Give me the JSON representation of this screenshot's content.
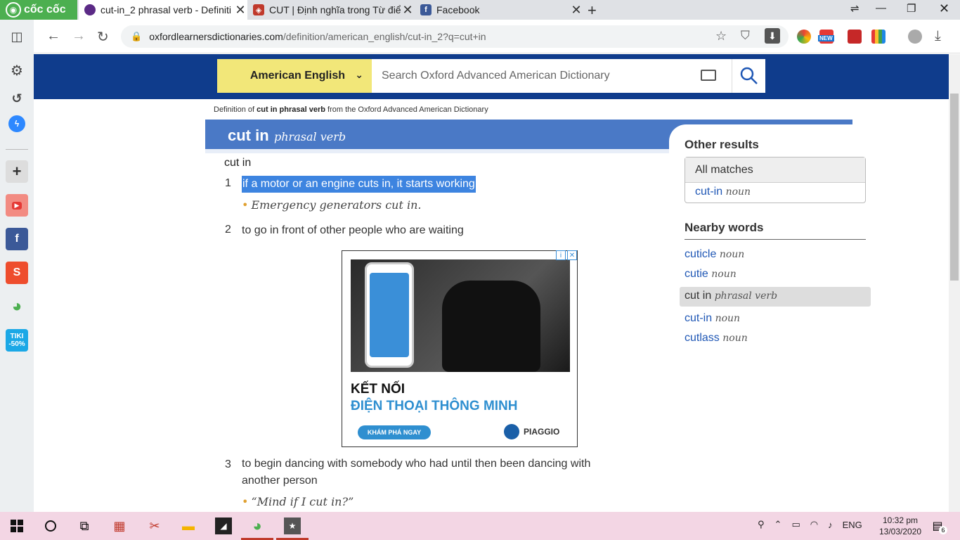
{
  "browser": {
    "brand": "cốc cốc",
    "tabs": [
      {
        "title": "cut-in_2 phrasal verb - Definiti"
      },
      {
        "title": "CUT | Định nghĩa trong Từ điể"
      },
      {
        "title": "Facebook"
      }
    ],
    "url_host": "oxfordlearnersdictionaries.com",
    "url_path": "/definition/american_english/cut-in_2?q=cut+in",
    "ext_new_badge": "NEW"
  },
  "sidebar": {
    "tiki_label": "TIKI\n-50%"
  },
  "header": {
    "language": "American English",
    "search_placeholder": "Search Oxford Advanced American Dictionary"
  },
  "entry": {
    "def_prefix": "Definition of",
    "def_word": "cut in phrasal verb",
    "def_suffix": "from the Oxford Advanced American Dictionary",
    "headword": "cut in",
    "pos": "phrasal verb",
    "phrase": "cut in",
    "senses": [
      {
        "num": "1",
        "text": "if a motor or an engine cuts in, it starts working",
        "example": "Emergency generators cut in."
      },
      {
        "num": "2",
        "text": "to go in front of other people who are waiting",
        "example": ""
      },
      {
        "num": "3",
        "text_line1": "to begin dancing with somebody who had until then been dancing with",
        "text_line2": "another person",
        "example": "“Mind if I cut in?”"
      }
    ]
  },
  "ad": {
    "title": "KẾT NỐI",
    "subtitle": "ĐIỆN THOẠI THÔNG MINH",
    "button": "KHÁM PHÁ NGAY",
    "brand": "PIAGGIO"
  },
  "right": {
    "other_results": "Other results",
    "all_matches": "All matches",
    "match_word": "cut-in",
    "match_pos": "noun",
    "nearby_title": "Nearby words",
    "nearby": [
      {
        "word": "cuticle",
        "pos": "noun"
      },
      {
        "word": "cutie",
        "pos": "noun"
      },
      {
        "word": "cut in",
        "pos": "phrasal verb"
      },
      {
        "word": "cut-in",
        "pos": "noun"
      },
      {
        "word": "cutlass",
        "pos": "noun"
      }
    ]
  },
  "taskbar": {
    "lang": "ENG",
    "time": "10:32 pm",
    "date": "13/03/2020",
    "notif_count": "6"
  }
}
